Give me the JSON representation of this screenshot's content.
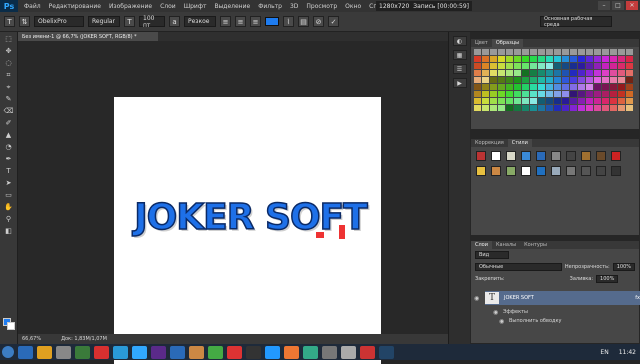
{
  "app": {
    "logo": "Ps"
  },
  "menu": [
    "Файл",
    "Редактирование",
    "Изображение",
    "Слои",
    "Шрифт",
    "Выделение",
    "Фильтр",
    "3D",
    "Просмотр",
    "Окно",
    "Справка"
  ],
  "recorder": {
    "resolution": "1280x720",
    "status": "Запись [00:00:59]"
  },
  "options": {
    "font": "ObelixPro",
    "style": "Regular",
    "size": "100 пт",
    "aa_label": "a",
    "aa_value": "Резкое",
    "color": "#1e7cf0"
  },
  "workspace": "Основная рабочая среда",
  "document_tab": "Без имени-1 @ 66,7% (JOKER SOFT, RGB/8) *",
  "canvas": {
    "text": "JOKER SOFT",
    "text_color": "#1e70e8"
  },
  "status": {
    "zoom": "66,67%",
    "doc": "Док: 1,83M/1,07M"
  },
  "mini_strip": [
    "Цвет",
    "Образцы"
  ],
  "swatches_panel": {
    "tabs": [
      "Цвет",
      "Образцы"
    ]
  },
  "styles_panel": {
    "tabs": [
      "Коррекция",
      "Стили"
    ]
  },
  "layers_panel": {
    "tabs": [
      "Слои",
      "Каналы",
      "Контуры"
    ],
    "filter": "Вид",
    "blend": "Обычные",
    "opacity_label": "Непрозрачность:",
    "opacity": "100%",
    "lock_label": "Закрепить:",
    "fill_label": "Заливка:",
    "fill": "100%",
    "layer_name": "JOKER SOFT",
    "layer_fx": "fx",
    "effects_label": "Эффекты",
    "effect": "Выполнить обводку"
  },
  "taskbar": {
    "lang": "EN",
    "time": "11:42"
  }
}
